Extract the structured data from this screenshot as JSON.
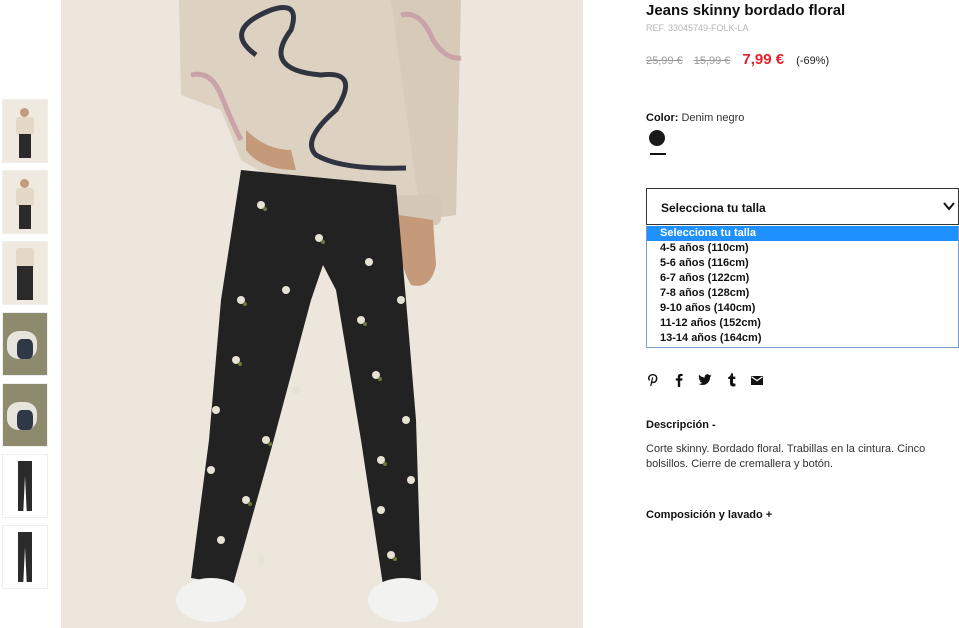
{
  "product": {
    "title": "Jeans skinny bordado floral",
    "ref": "REF. 33045749-FOLK-LA",
    "old_price_1": "25,99 €",
    "old_price_2": "15,99 €",
    "price": "7,99 €",
    "discount": "(-69%)"
  },
  "color": {
    "label": "Color:",
    "value": "Denim negro",
    "swatch": "#1a1a1a"
  },
  "size": {
    "placeholder": "Selecciona tu talla",
    "options": [
      "Selecciona tu talla",
      "4-5 años (110cm)",
      "5-6 años (116cm)",
      "6-7 años (122cm)",
      "7-8 años (128cm)",
      "9-10 años (140cm)",
      "11-12 años (152cm)",
      "13-14 años (164cm)"
    ],
    "highlight_color": "#1e90ff"
  },
  "share_icons": [
    "pinterest-icon",
    "facebook-icon",
    "twitter-icon",
    "tumblr-icon",
    "email-icon"
  ],
  "description": {
    "heading": "Descripción -",
    "text": "Corte skinny. Bordado floral. Trabillas en la cintura. Cinco bolsillos. Cierre de cremallera y botón."
  },
  "composition": {
    "heading": "Composición y lavado +"
  },
  "colors": {
    "sale_red": "#e4202a"
  }
}
